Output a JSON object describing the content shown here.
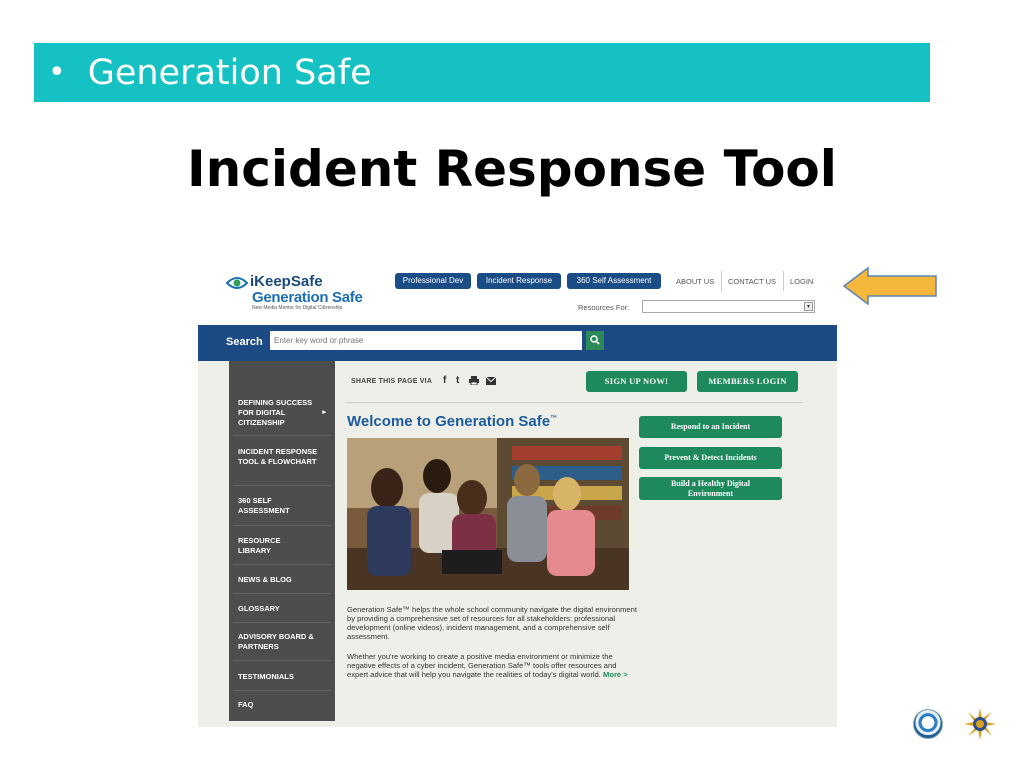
{
  "slide": {
    "bullet": "•",
    "banner_text": "Generation Safe",
    "title": "Incident Response Tool"
  },
  "site": {
    "logo_line1": "iKeepSafe",
    "logo_line2": "Generation Safe",
    "logo_tagline": "New Media Mentor for Digital Citizenship",
    "top_buttons": [
      "Professional Dev",
      "Incident Response",
      "360 Self Assessment"
    ],
    "top_links": [
      "ABOUT US",
      "CONTACT US",
      "LOGIN"
    ],
    "resources_label": "Resources For:",
    "resources_value": "",
    "search_label": "Search",
    "search_placeholder": "Enter key word or phrase",
    "search_icon": "magnifier-icon",
    "sidebar": [
      {
        "label": "Defining Success For Digital Citizenship",
        "has_submenu": true
      },
      {
        "label": "Incident Response Tool & Flowchart"
      },
      {
        "label": "360 Self Assessment"
      },
      {
        "label": "Resource Library"
      },
      {
        "label": "News & Blog"
      },
      {
        "label": "Glossary"
      },
      {
        "label": "Advisory Board & Partners"
      },
      {
        "label": "Testimonials"
      },
      {
        "label": "FAQ"
      }
    ],
    "share_label": "SHARE THIS PAGE VIA",
    "share_icons": [
      "facebook-icon",
      "twitter-icon",
      "print-icon",
      "email-icon"
    ],
    "signup_label": "SIGN UP NOW!",
    "members_login_label": "MEMBERS LOGIN",
    "welcome_title": "Welcome to Generation Safe",
    "welcome_tm": "™",
    "action_buttons": [
      "Respond to an Incident",
      "Prevent & Detect Incidents",
      "Build a Healthy Digital Environment"
    ],
    "paragraph1": "Generation Safe™ helps the whole school community navigate the digital environment by providing a comprehensive set of resources for all stakeholders: professional development (online videos), incident management, and a comprehensive self assessment.",
    "paragraph2": "Whether you're working to create a positive media environment or minimize the negative effects of a cyber incident, Generation Safe™ tools offer resources and expert advice that will help you navigate the realities of today's digital world.",
    "more_link": "More >"
  },
  "colors": {
    "banner": "#15c1c2",
    "site_navy": "#1b4a84",
    "site_green": "#1e8a5c",
    "sidebar_gray": "#4d4d4d",
    "arrow": "#f5b83d"
  }
}
